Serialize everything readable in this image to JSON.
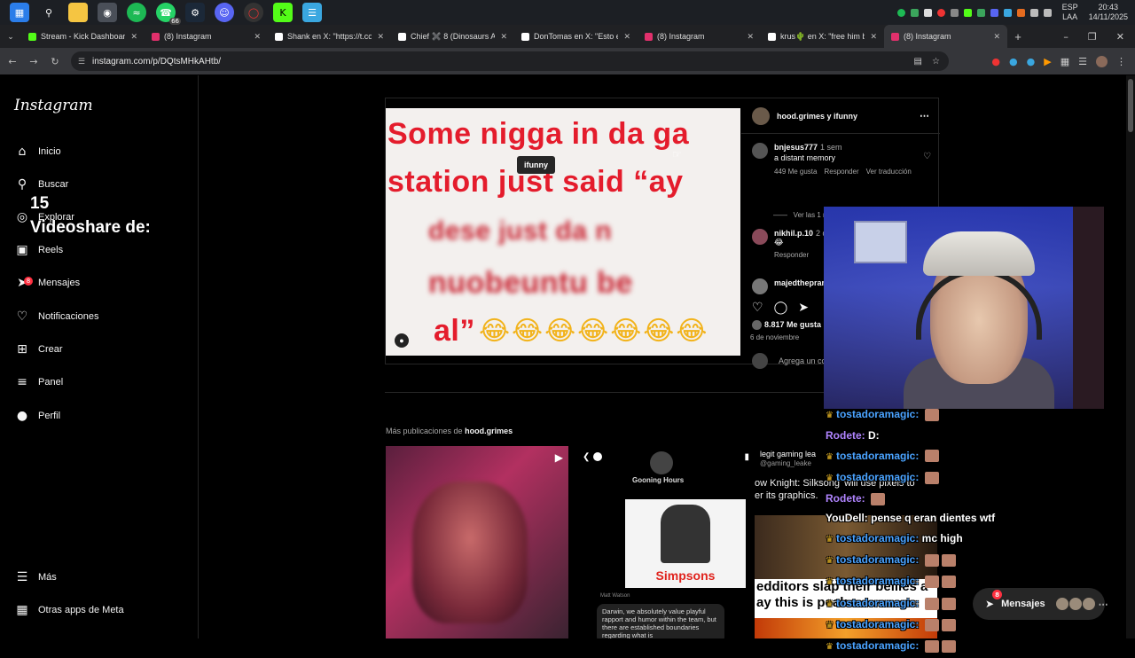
{
  "taskbar": {
    "icons": [
      "windows-start-icon",
      "search-icon",
      "file-explorer-icon",
      "chrome-icon",
      "spotify-icon",
      "whatsapp-icon",
      "steam-icon",
      "discord-icon",
      "app-icon",
      "kick-icon",
      "notepad-icon"
    ],
    "whatsapp_badge": "66",
    "lang_top": "ESP",
    "lang_bottom": "LAA",
    "time": "20:43",
    "date": "14/11/2025"
  },
  "tabs": [
    {
      "label": "Stream - Kick Dashboard",
      "color": "#53fc18"
    },
    {
      "label": "(8) Instagram",
      "color": "#e1306c"
    },
    {
      "label": "Shank en X: \"https://t.co/...",
      "color": "#ffffff"
    },
    {
      "label": "Chief ✖️ 8 (Dinosaurs Ar...",
      "color": "#ffffff"
    },
    {
      "label": "DonTomas en X: \"Esto es...",
      "color": "#ffffff"
    },
    {
      "label": "(8) Instagram",
      "color": "#e1306c"
    },
    {
      "label": "krus🌵 en X: \"free him b...",
      "color": "#ffffff"
    },
    {
      "label": "(8) Instagram",
      "color": "#e1306c",
      "active": true
    }
  ],
  "address": {
    "url": "instagram.com/p/DQtsMHkAHtb/"
  },
  "sidebar": {
    "logo": "Instagram",
    "items": [
      {
        "label": "Inicio",
        "icon": "home-icon"
      },
      {
        "label": "Buscar",
        "icon": "search-icon"
      },
      {
        "label": "Explorar",
        "icon": "compass-icon"
      },
      {
        "label": "Reels",
        "icon": "reels-icon"
      },
      {
        "label": "Mensajes",
        "icon": "messenger-icon",
        "badge": "8"
      },
      {
        "label": "Notificaciones",
        "icon": "heart-icon"
      },
      {
        "label": "Crear",
        "icon": "plus-square-icon"
      },
      {
        "label": "Panel",
        "icon": "chart-icon"
      },
      {
        "label": "Perfil",
        "icon": "avatar-icon"
      }
    ],
    "more": "Más",
    "meta_apps": "Otras apps de Meta"
  },
  "overlay": {
    "count": "15",
    "videoshare": "Videoshare de:"
  },
  "post": {
    "meme_lines": [
      "Some nigga in da ga",
      "station just said “ay",
      "dese just da n",
      "nuobeuntu be",
      "al”"
    ],
    "emojis": "😂😂😂😂😂😂😂",
    "tag": "ifunny",
    "header": "hood.grimes y ifunny",
    "comments": [
      {
        "user": "bnjesus777",
        "time": "1 sem",
        "text": "a distant memory",
        "likes": "449 Me gusta",
        "reply": "Responder",
        "translate": "Ver traducción"
      },
      {
        "user": "nikhil.p.10",
        "time": "2 d",
        "text": "😂",
        "reply": "Responder"
      },
      {
        "user": "majedthepran",
        "time": "",
        "text": ""
      }
    ],
    "view_replies": "Ver las 1 respuestas",
    "likes": "8.817 Me gusta",
    "date": "6 de noviembre",
    "add_comment": "Agrega un co"
  },
  "more_pubs": {
    "prefix": "Más publicaciones de",
    "user": "hood.grimes"
  },
  "grid": {
    "g2_header": "Gooning Hours",
    "g2_show": "Simpsons",
    "g2_sender": "Matt Watson",
    "g2_msg": "Darwin, we absolutely value playful rapport and humor within the team, but there are established boundaries regarding what is",
    "g3_title": "legit gaming lea",
    "g3_sub": "@gaming_leake",
    "g3_text": "ow Knight: Silksong' will use pixels to\ner its graphics.",
    "g3_caption": "edditors slap their bellies a\nay this is peak"
  },
  "chat": [
    {
      "user": "tostadoramagic:",
      "kind": "tos",
      "msg": "",
      "emotes": 1
    },
    {
      "user": "Rodete:",
      "kind": "rod",
      "msg": "D:",
      "emotes": 0
    },
    {
      "user": "tostadoramagic:",
      "kind": "tos",
      "msg": "",
      "emotes": 1
    },
    {
      "user": "tostadoramagic:",
      "kind": "tos",
      "msg": "",
      "emotes": 1
    },
    {
      "user": "Rodete:",
      "kind": "rod",
      "msg": "",
      "emotes": 1
    },
    {
      "user": "YouDell:",
      "kind": "you",
      "msg": "pense q eran dientes wtf",
      "emotes": 0
    },
    {
      "user": "tostadoramagic:",
      "kind": "tos",
      "msg": "mc high",
      "emotes": 0
    },
    {
      "user": "tostadoramagic:",
      "kind": "tos",
      "msg": "",
      "emotes": 2
    },
    {
      "user": "tostadoramagic:",
      "kind": "tos",
      "msg": "",
      "emotes": 2
    },
    {
      "user": "tostadoramagic:",
      "kind": "tos",
      "msg": "",
      "emotes": 2
    },
    {
      "user": "tostadoramagic:",
      "kind": "tos",
      "msg": "",
      "emotes": 2
    },
    {
      "user": "tostadoramagic:",
      "kind": "tos",
      "msg": "",
      "emotes": 2
    }
  ],
  "messages_pill": {
    "label": "Mensajes",
    "badge": "8"
  }
}
